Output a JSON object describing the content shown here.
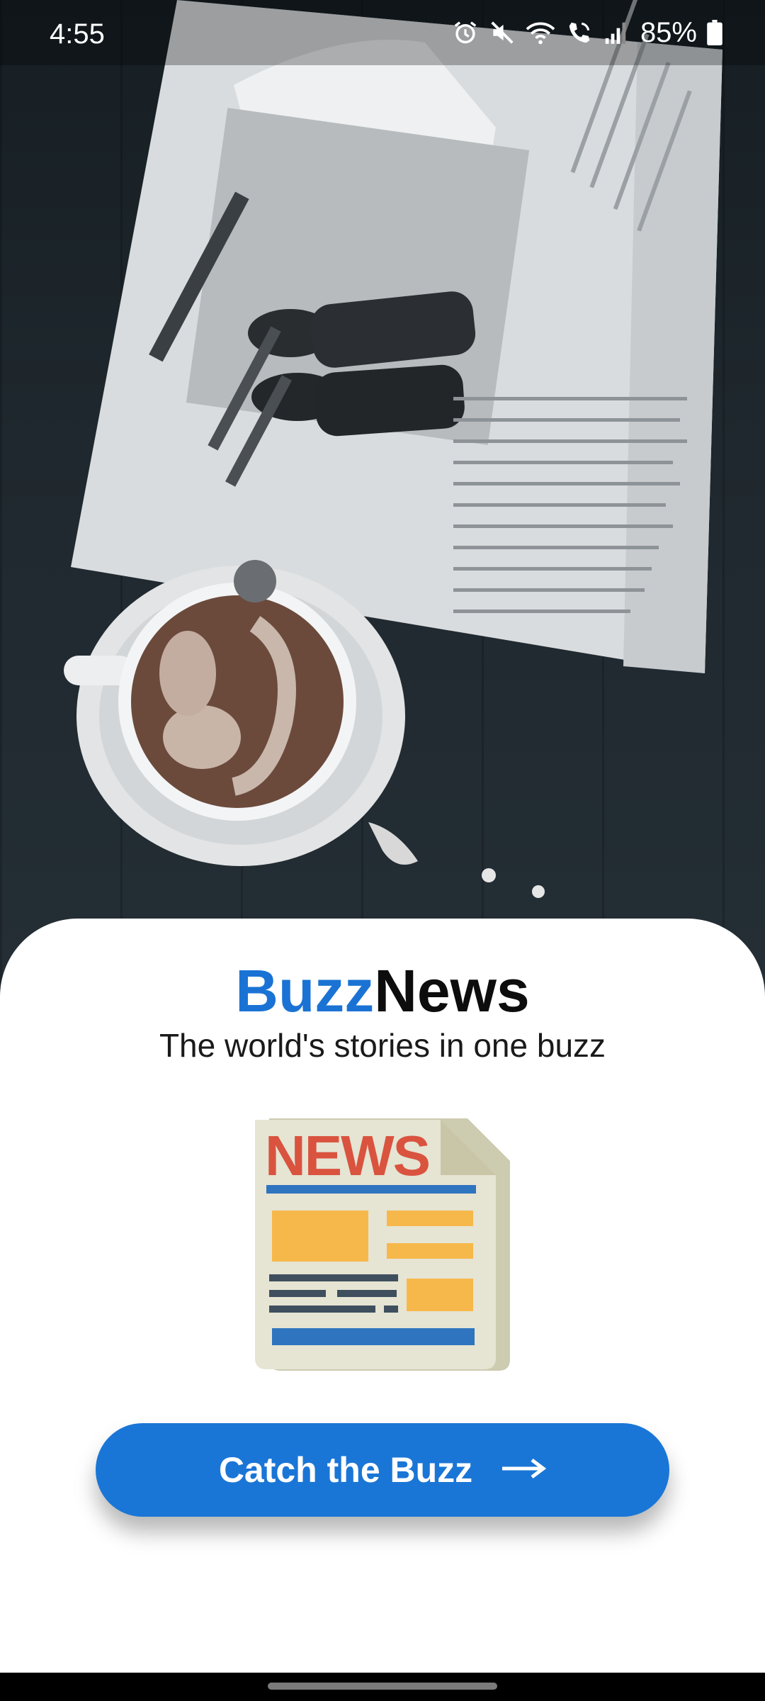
{
  "status_bar": {
    "time": "4:55",
    "battery_percent": "85%",
    "icons": [
      "alarm-icon",
      "mute-icon",
      "wifi-icon",
      "wifi-calling-icon",
      "signal-icon",
      "battery-icon"
    ]
  },
  "hero": {
    "image": "newspaper-and-latte-photo"
  },
  "brand": {
    "part1": "Buzz",
    "part2": "News",
    "part1_color": "#1a73d4",
    "part2_color": "#0d0d0d"
  },
  "tagline": "The world's stories in one buzz",
  "illustration": {
    "icon": "newspaper-icon",
    "label": "NEWS"
  },
  "cta": {
    "label": "Catch the Buzz",
    "icon": "arrow-right-icon",
    "color": "#1a76d6"
  },
  "colors": {
    "accent": "#1a76d6",
    "sheet_background": "#ffffff"
  }
}
